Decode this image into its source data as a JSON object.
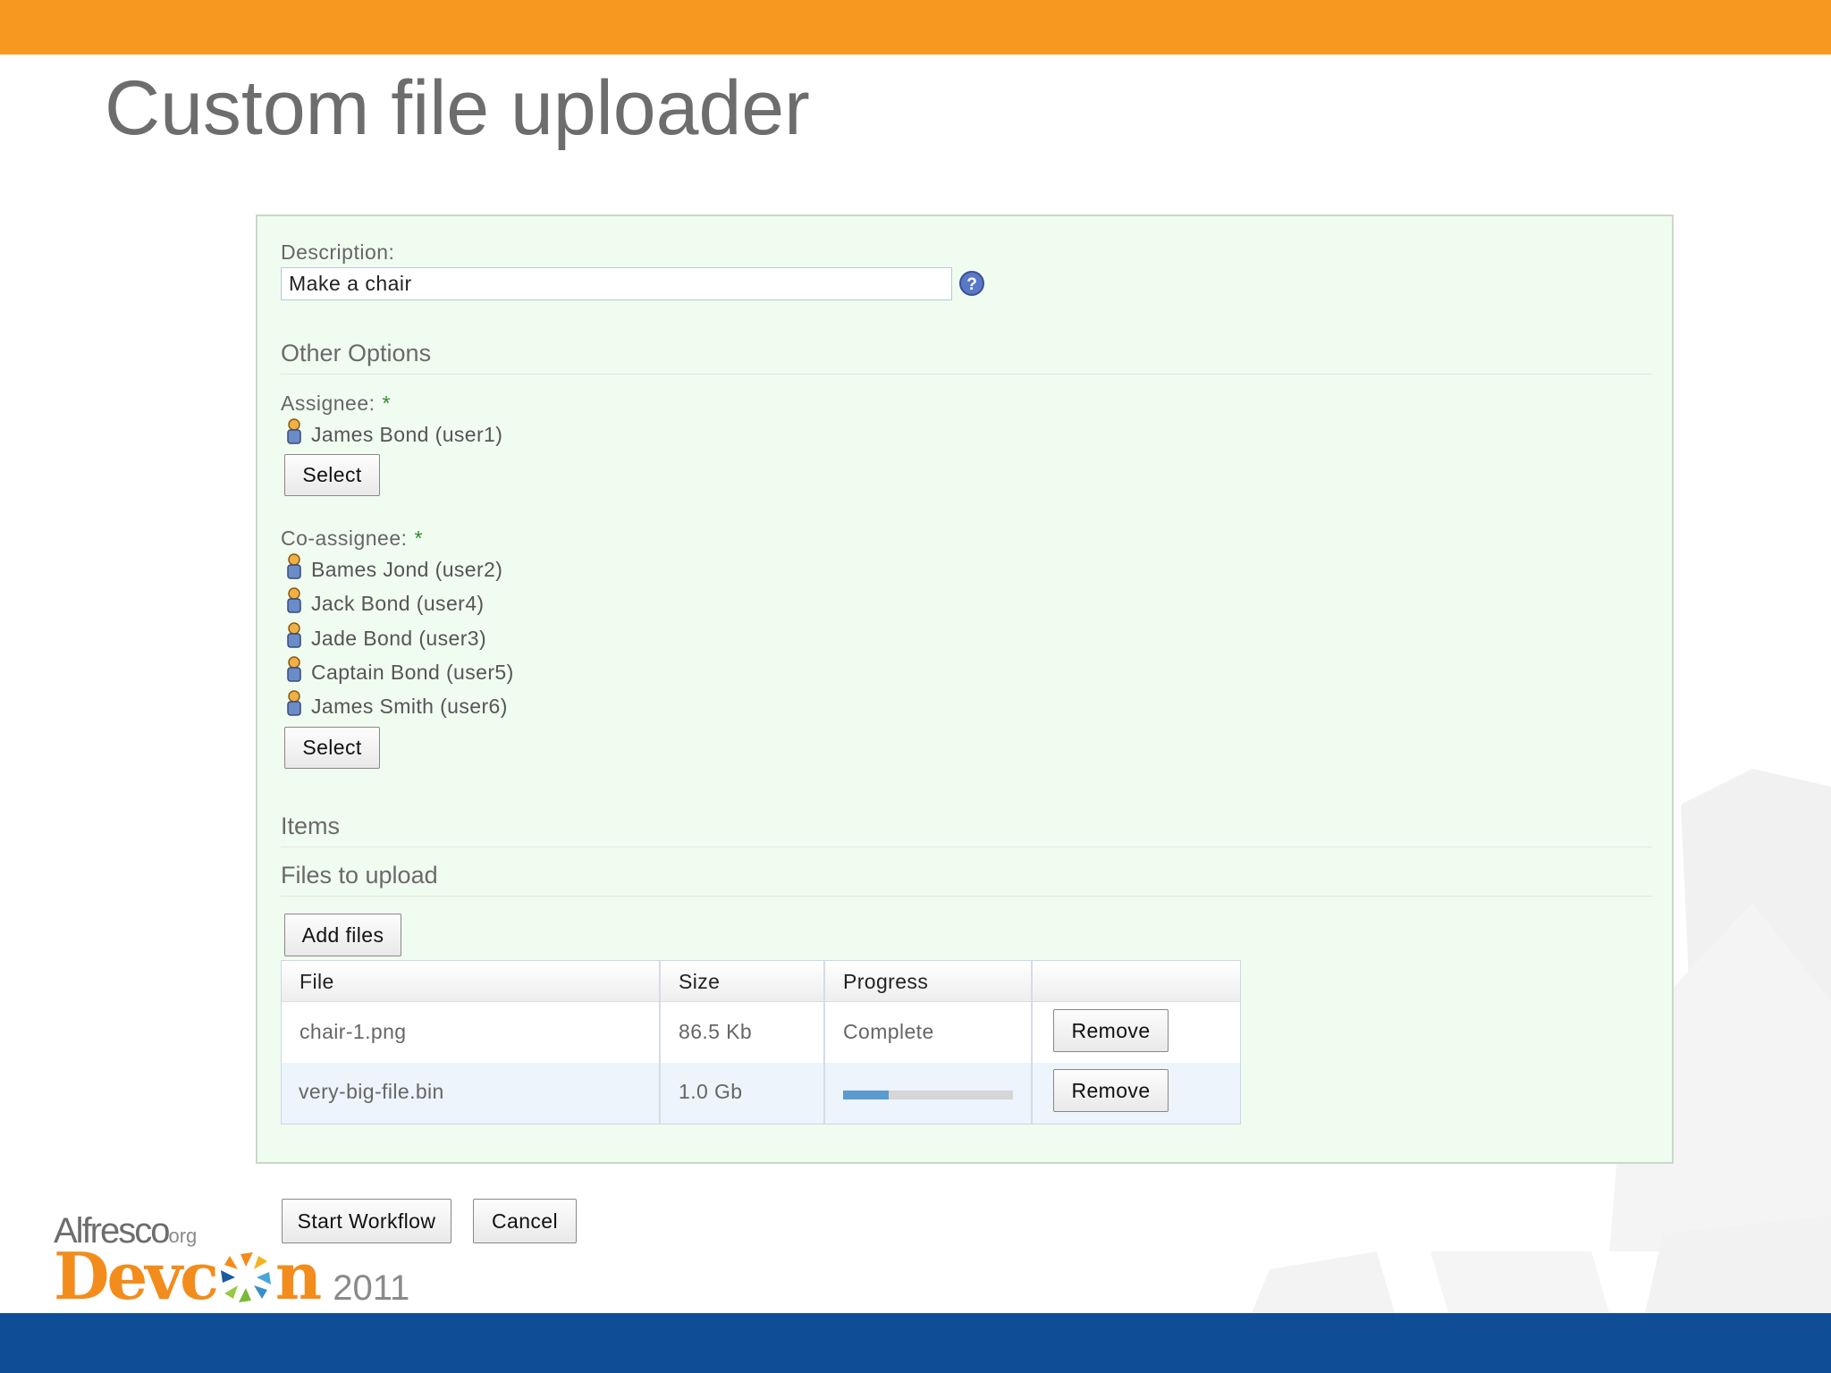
{
  "slide": {
    "title": "Custom file uploader"
  },
  "colors": {
    "top_bar": "#f7991f",
    "bottom_bar": "#0f4e97",
    "panel": "#f1fcf0",
    "progress": "#5b9bd0"
  },
  "form": {
    "description_label": "Description:",
    "description_value": "Make a chair",
    "help_icon": "question-circle-icon",
    "other_options": "Other Options",
    "assignee_label": "Assignee:",
    "required_marker": "*",
    "assignee": [
      "James Bond (user1)"
    ],
    "co_assignee_label": "Co-assignee:",
    "co_assignees": [
      "Bames Jond (user2)",
      "Jack Bond (user4)",
      "Jade Bond (user3)",
      "Captain Bond (user5)",
      "James Smith (user6)"
    ],
    "select_label": "Select",
    "items_heading": "Items",
    "files_heading": "Files to upload",
    "add_files_label": "Add files"
  },
  "table": {
    "headers": [
      "File",
      "Size",
      "Progress",
      ""
    ],
    "rows": [
      {
        "file": "chair-1.png",
        "size": "86.5 Kb",
        "progress": "Complete",
        "progress_fraction": 1.0,
        "action": "Remove"
      },
      {
        "file": "very-big-file.bin",
        "size": "1.0 Gb",
        "progress": "",
        "progress_fraction": 0.27,
        "action": "Remove"
      }
    ]
  },
  "actions": {
    "start_label": "Start Workflow",
    "cancel_label": "Cancel"
  },
  "branding": {
    "brand": "Alfresco",
    "brand_suffix": "org",
    "event_a": "Devc",
    "event_b": "n",
    "year": "2011"
  }
}
